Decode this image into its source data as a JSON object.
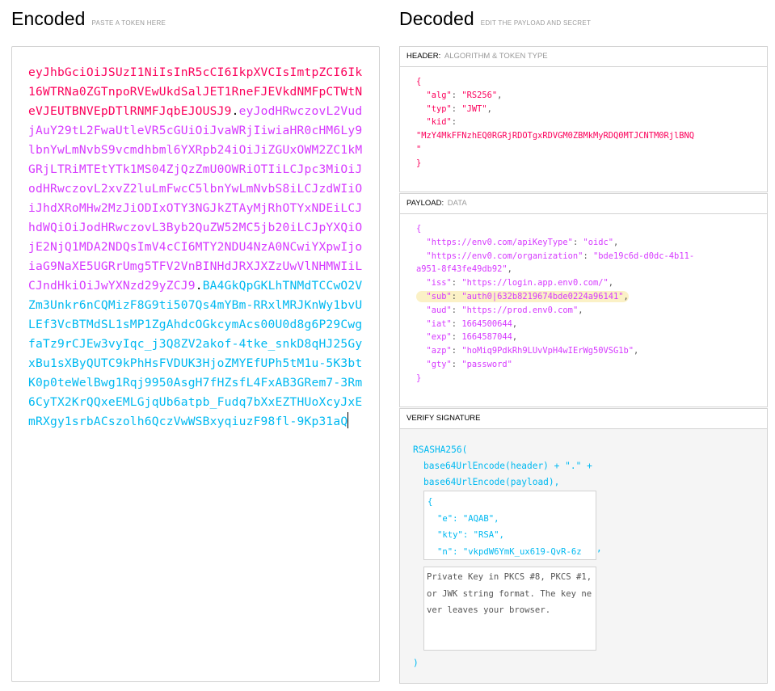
{
  "encoded": {
    "title": "Encoded",
    "subtitle": "PASTE A TOKEN HERE",
    "token_header": "eyJhbGciOiJSUzI1NiIsInR5cCI6IkpXVCIsImtpZCI6Ik16WTRNa0ZGTnpoRVEwUkdSalJET1RneFJEVkdNMFpCTWtNeVJEUTBNVEpDTlRNMFJqbEJOUSJ9",
    "token_payload": "eyJodHRwczovL2VudjAuY29tL2FwaUtleVR5cGUiOiJvaWRjIiwiaHR0cHM6Ly9lbnYwLmNvbS9vcmdhbml6YXRpb24iOiJiZGUxOWM2ZC1kMGRjLTRiMTEtYTk1MS04ZjQzZmU0OWRiOTIiLCJpc3MiOiJodHRwczovL2xvZ2luLmFwcC5lbnYwLmNvbS8iLCJzdWIiOiJhdXRoMHw2MzJiODIxOTY3NGJkZTAyMjRhOTYxNDEiLCJhdWQiOiJodHRwczovL3Byb2QuZW52MC5jb20iLCJpYXQiOjE2NjQ1MDA2NDQsImV4cCI6MTY2NDU4NzA0NCwiYXpwIjoiaG9NaXE5UGRrUmg5TFV2VnBINHdJRXJXZzUwVlNHMWIiLCJndHkiOiJwYXNzd29yZCJ9",
    "token_signature": "BA4GkQpGKLhTNMdTCCwO2VZm3Unkr6nCQMizF8G9ti507Qs4mYBm-RRxlMRJKnWy1bvULEf3VcBTMdSL1sMP1ZgAhdcOGkcymAcs00U0d8g6P29CwgfaTz9rCJEw3vyIqc_j3Q8ZV2akof-4tke_snkD8qHJ25GyxBu1sXByQUTC9kPhHsFVDUK3HjoZMYEfUPh5tM1u-5K3btK0p0teWelBwg1Rqj9950AsgH7fHZsfL4FxAB3GRem7-3Rm6CyTX2KrQQxeEMLGjqUb6atpb_Fudq7bXxEZTHUoXcyJxEmRXgy1srbACszolh6QczVwWSBxyqiuzF98fl-9Kp31aQ",
    "dot": "."
  },
  "decoded": {
    "title": "Decoded",
    "subtitle": "EDIT THE PAYLOAD AND SECRET"
  },
  "header_panel": {
    "label": "HEADER:",
    "sublabel": "ALGORITHM & TOKEN TYPE",
    "open": "{",
    "close": "}",
    "alg_key": "\"alg\"",
    "alg_val": "\"RS256\"",
    "typ_key": "\"typ\"",
    "typ_val": "\"JWT\"",
    "kid_key": "\"kid\"",
    "kid_val_1": "\"MzY4MkFFNzhEQ0RGRjRDOTgxRDVGM0ZBMkMyRDQ0MTJCNTM0RjlBNQ",
    "kid_val_2": "\""
  },
  "payload_panel": {
    "label": "PAYLOAD:",
    "sublabel": "DATA",
    "open": "{",
    "close": "}",
    "rows": [
      {
        "k": "\"https://env0.com/apiKeyType\"",
        "v": "\"oidc\"",
        "sep": ",",
        "hl": false
      },
      {
        "k": "\"https://env0.com/organization\"",
        "v": "\"bde19c6d-d0dc-4b11-",
        "sep": "",
        "hl": false
      },
      {
        "k": "",
        "v": "a951-8f43fe49db92\"",
        "sep": ",",
        "hl": false,
        "cont": true
      },
      {
        "k": "\"iss\"",
        "v": "\"https://login.app.env0.com/\"",
        "sep": ",",
        "hl": false
      },
      {
        "k": "\"sub\"",
        "v": "\"auth0|632b8219674bde0224a96141\"",
        "sep": ",",
        "hl": true
      },
      {
        "k": "\"aud\"",
        "v": "\"https://prod.env0.com\"",
        "sep": ",",
        "hl": false
      },
      {
        "k": "\"iat\"",
        "v": "1664500644",
        "sep": ",",
        "hl": false
      },
      {
        "k": "\"exp\"",
        "v": "1664587044",
        "sep": ",",
        "hl": false
      },
      {
        "k": "\"azp\"",
        "v": "\"hoMiq9PdkRh9LUvVpH4wIErWg50VSG1b\"",
        "sep": ",",
        "hl": false
      },
      {
        "k": "\"gty\"",
        "v": "\"password\"",
        "sep": "",
        "hl": false
      }
    ]
  },
  "verify_panel": {
    "label": "VERIFY SIGNATURE",
    "line1": "RSASHA256(",
    "line2": "base64UrlEncode(header) + \".\" +",
    "line3": "base64UrlEncode(payload),",
    "pub_open": "{",
    "pub_e": "\"e\": \"AQAB\",",
    "pub_kty": "\"kty\": \"RSA\",",
    "pub_n": "\"n\": \"vkpdW6YmK_ux619-QvR-6z",
    "comma": ",",
    "private_placeholder": "Private Key in PKCS #8, PKCS #1, or JWK string format. The key never leaves your browser.",
    "close": ")"
  },
  "colors": {
    "header": "#fb015b",
    "payload": "#d63aff",
    "signature": "#00b9f1",
    "highlight": "#fbf1c6"
  }
}
